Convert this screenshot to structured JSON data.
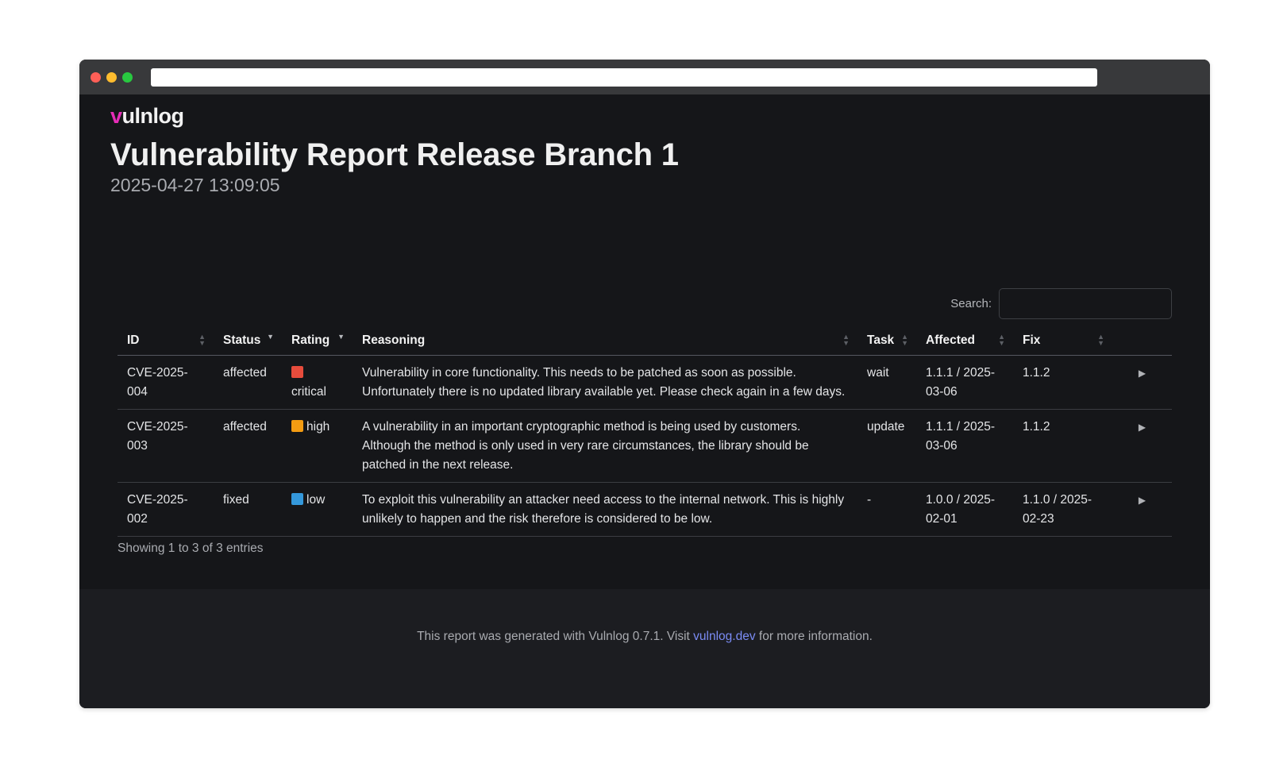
{
  "logo": {
    "v": "v",
    "rest": "ulnlog"
  },
  "report": {
    "title": "Vulnerability Report Release Branch 1",
    "timestamp": "2025-04-27 13:09:05"
  },
  "search": {
    "label": "Search:",
    "value": ""
  },
  "table": {
    "columns": [
      "ID",
      "Status",
      "Rating",
      "Reasoning",
      "Task",
      "Affected",
      "Fix"
    ],
    "rows": [
      {
        "id": "CVE-2025-004",
        "status": "affected",
        "rating": "critical",
        "rating_color": "#e74c3c",
        "reasoning": "Vulnerability in core functionality. This needs to be patched as soon as possible. Unfortunately there is no updated library available yet. Please check again in a few days.",
        "task": "wait",
        "affected": "1.1.1 / 2025-03-06",
        "fix": "1.1.2",
        "expand": "▶"
      },
      {
        "id": "CVE-2025-003",
        "status": "affected",
        "rating": "high",
        "rating_color": "#f39c12",
        "reasoning": "A vulnerability in an important cryptographic method is being used by customers. Although the method is only used in very rare circumstances, the library should be patched in the next release.",
        "task": "update",
        "affected": "1.1.1 / 2025-03-06",
        "fix": "1.1.2",
        "expand": "▶"
      },
      {
        "id": "CVE-2025-002",
        "status": "fixed",
        "rating": "low",
        "rating_color": "#3498db",
        "reasoning": "To exploit this vulnerability an attacker need access to the internal network. This is highly unlikely to happen and the risk therefore is considered to be low.",
        "task": "-",
        "affected": "1.0.0 / 2025-02-01",
        "fix": "1.1.0 / 2025-02-23",
        "expand": "▶"
      }
    ]
  },
  "info": "Showing 1 to 3 of 3 entries",
  "footer": {
    "prefix": "This report was generated with Vulnlog 0.7.1. Visit ",
    "link": "vulnlog.dev",
    "suffix": " for more information."
  }
}
